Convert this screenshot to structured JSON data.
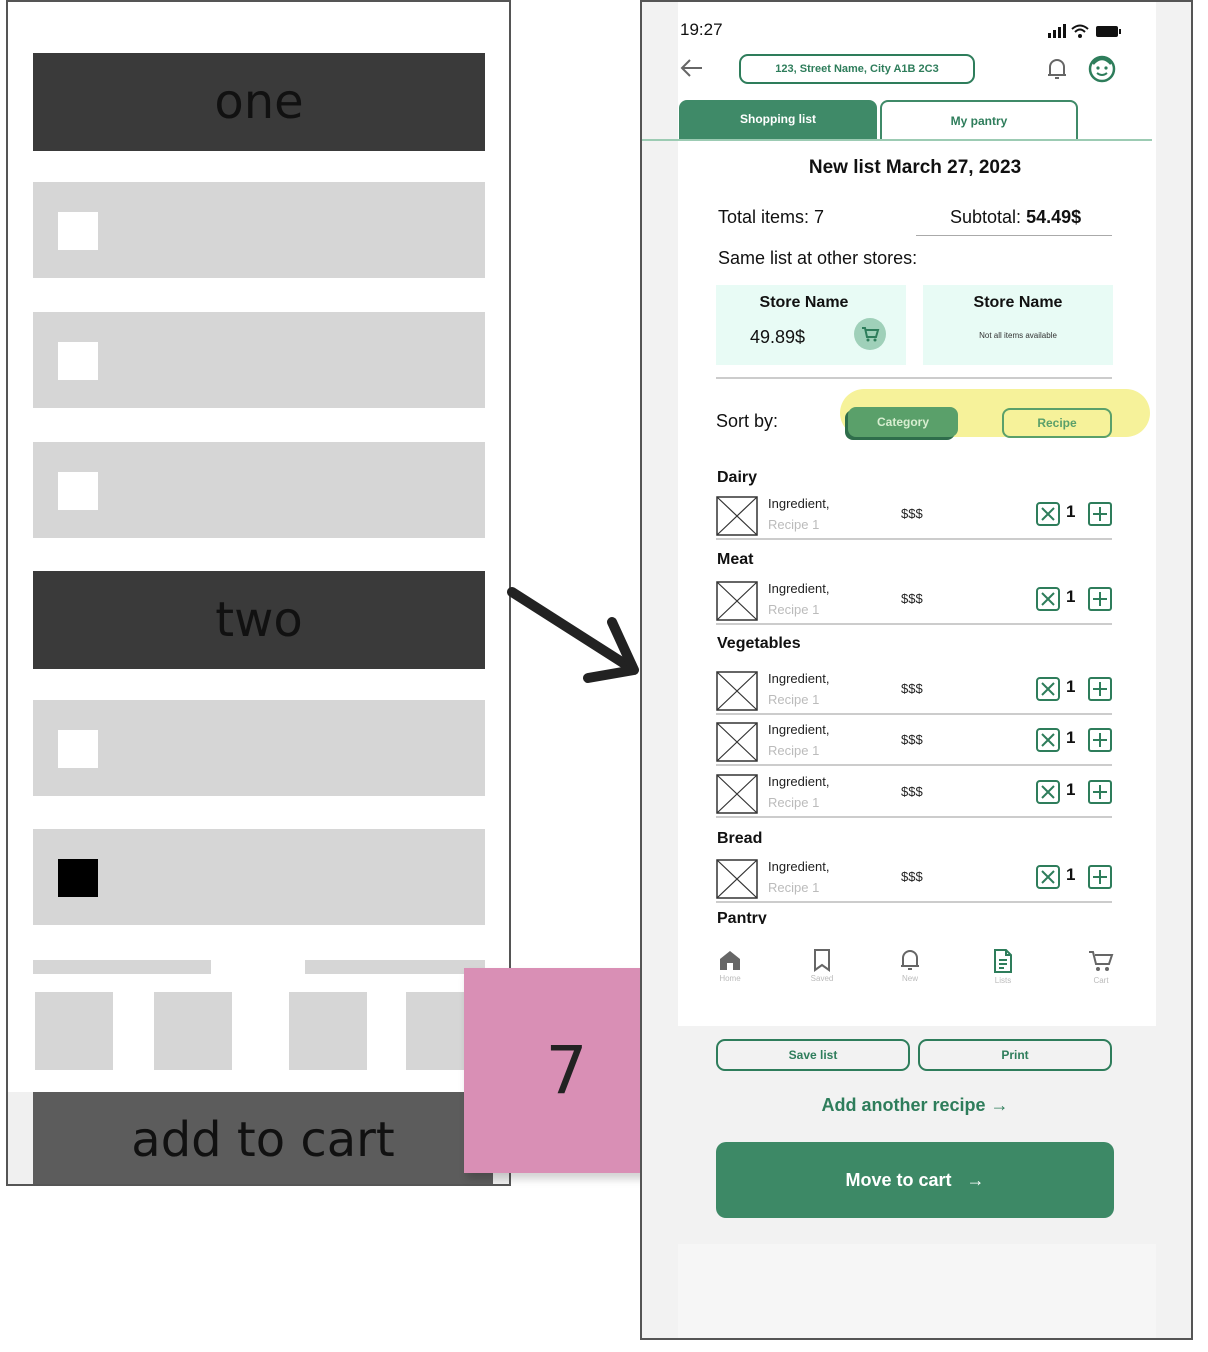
{
  "wireframe": {
    "section_one": "one",
    "section_two": "two",
    "add_to_cart": "add to cart"
  },
  "sticky_note": {
    "text": "7",
    "color": "#d98fb5"
  },
  "phone": {
    "status": {
      "time": "19:27"
    },
    "header": {
      "address": "123, Street Name, City A1B 2C3"
    },
    "tabs": [
      {
        "label": "Shopping list",
        "active": true
      },
      {
        "label": "My pantry",
        "active": false
      }
    ],
    "list_title": "New list March 27, 2023",
    "summary": {
      "total_items": "Total items: 7",
      "subtotal_label": "Subtotal:",
      "subtotal_value": "54.49$"
    },
    "other_stores_label": "Same list at other stores:",
    "stores": [
      {
        "name": "Store Name",
        "price": "49.89$"
      },
      {
        "name": "Store Name",
        "note": "Not all items available"
      }
    ],
    "sort": {
      "label": "Sort by:",
      "options": [
        "Category",
        "Recipe"
      ],
      "selected": "Category"
    },
    "categories": [
      {
        "name": "Dairy",
        "items": [
          {
            "name": "Ingredient,",
            "recipe": "Recipe 1",
            "price": "$$$",
            "qty": "1"
          }
        ]
      },
      {
        "name": "Meat",
        "items": [
          {
            "name": "Ingredient,",
            "recipe": "Recipe 1",
            "price": "$$$",
            "qty": "1"
          }
        ]
      },
      {
        "name": "Vegetables",
        "items": [
          {
            "name": "Ingredient,",
            "recipe": "Recipe 1",
            "price": "$$$",
            "qty": "1"
          },
          {
            "name": "Ingredient,",
            "recipe": "Recipe 1",
            "price": "$$$",
            "qty": "1"
          },
          {
            "name": "Ingredient,",
            "recipe": "Recipe 1",
            "price": "$$$",
            "qty": "1"
          }
        ]
      },
      {
        "name": "Bread",
        "items": [
          {
            "name": "Ingredient,",
            "recipe": "Recipe 1",
            "price": "$$$",
            "qty": "1"
          }
        ]
      },
      {
        "name": "Pantry",
        "items": []
      }
    ],
    "bottom_nav": [
      {
        "label": "Home",
        "icon": "home-icon"
      },
      {
        "label": "Saved",
        "icon": "bookmark-icon"
      },
      {
        "label": "New",
        "icon": "bell-icon"
      },
      {
        "label": "Lists",
        "icon": "document-icon"
      },
      {
        "label": "Cart",
        "icon": "cart-icon"
      }
    ],
    "actions": {
      "save_list": "Save list",
      "print": "Print",
      "add_recipe": "Add another recipe →",
      "move_to_cart": "Move to cart   →"
    },
    "colors": {
      "primary": "#3d8966",
      "highlight": "#f6f29a",
      "store_bg": "#e8fbf5"
    }
  }
}
